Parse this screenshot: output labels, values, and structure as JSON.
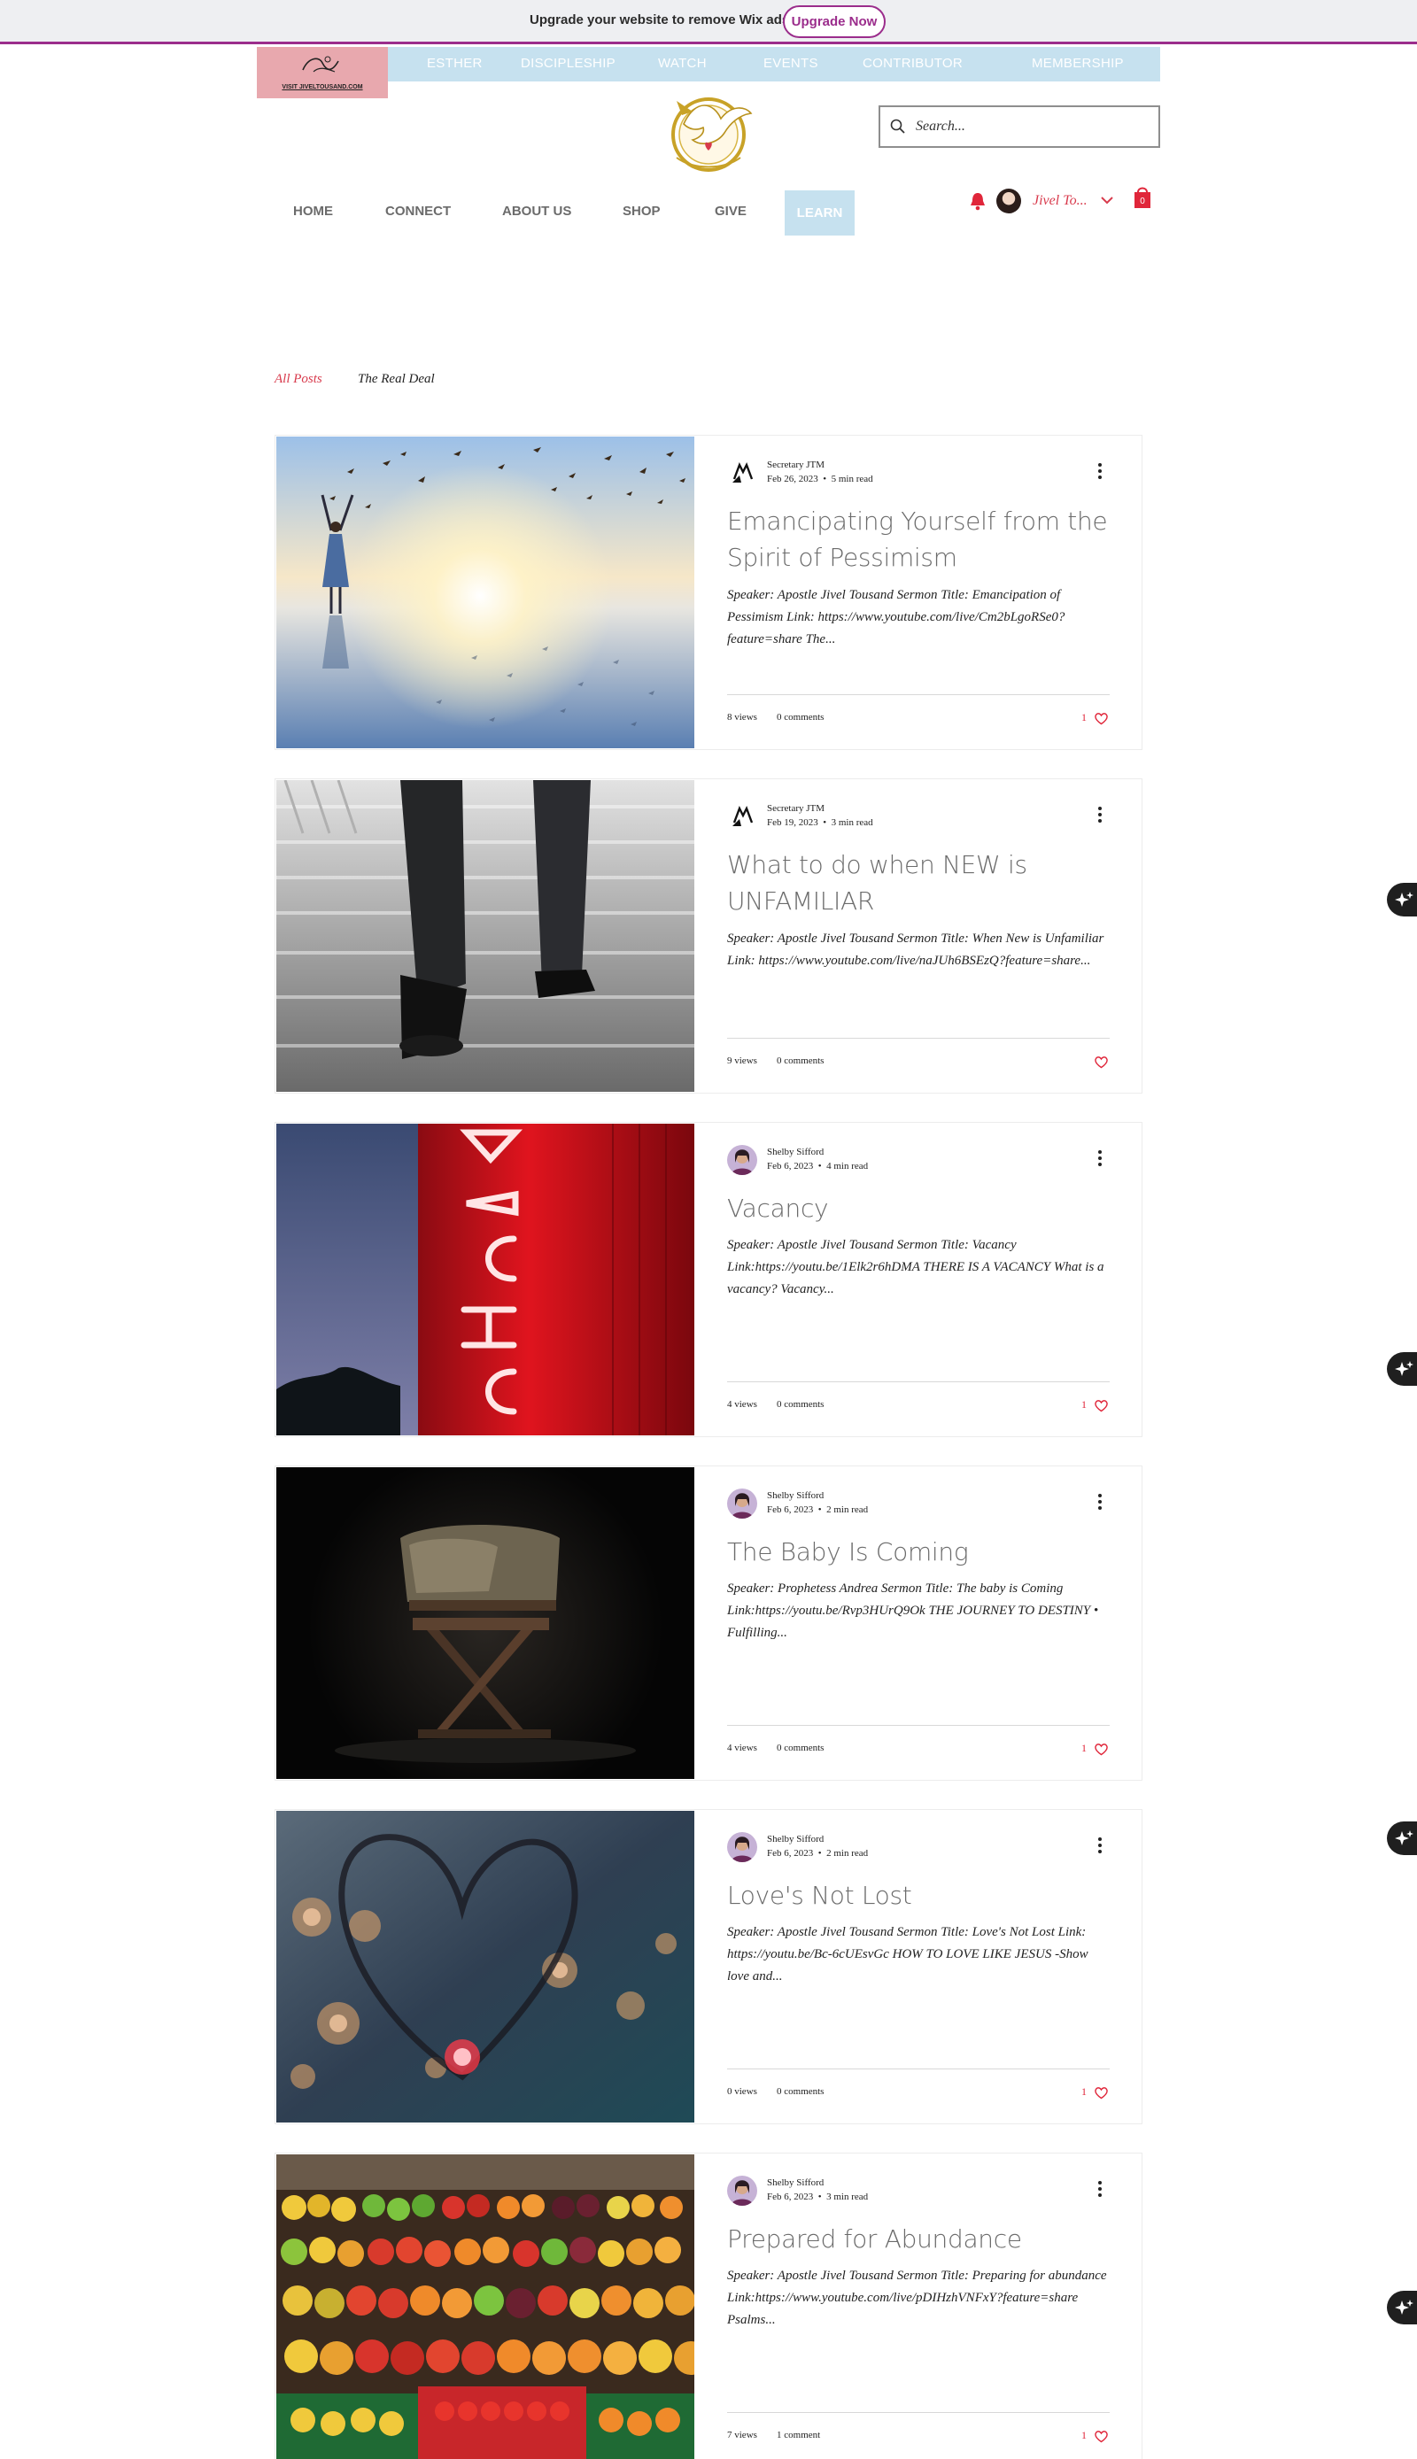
{
  "wix_bar": {
    "message": "Upgrade your website to remove Wix ads",
    "button": "Upgrade Now"
  },
  "logo_text": "VISIT JIVELTOUSAND.COM",
  "top_strip": [
    "ESTHER",
    "DISCIPLESHIP",
    "WATCH",
    "EVENTS",
    "CONTRIBUTOR",
    "MEMBERSHIP"
  ],
  "search": {
    "placeholder": "Search..."
  },
  "nav": [
    "HOME",
    "CONNECT",
    "ABOUT US",
    "SHOP",
    "GIVE",
    "LEARN"
  ],
  "user": {
    "name": "Jivel To...",
    "cart_count": "0"
  },
  "filters": {
    "all": "All Posts",
    "category": "The Real Deal"
  },
  "posts": [
    {
      "author": "Secretary JTM",
      "date": "Feb 26, 2023",
      "read": "5 min read",
      "title": "Emancipating Yourself from the Spirit of Pessimism",
      "excerpt": "Speaker: Apostle Jivel Tousand Sermon Title: Emancipation of Pessimism Link: https://www.youtube.com/live/Cm2bLgoRSe0?feature=share The...",
      "views": "8 views",
      "comments": "0 comments",
      "likes": "1"
    },
    {
      "author": "Secretary JTM",
      "date": "Feb 19, 2023",
      "read": "3 min read",
      "title": "What to do when NEW is UNFAMILIAR",
      "excerpt": "Speaker: Apostle Jivel Tousand Sermon Title: When New is Unfamiliar Link: https://www.youtube.com/live/naJUh6BSEzQ?feature=share...",
      "views": "9 views",
      "comments": "0 comments",
      "likes": ""
    },
    {
      "author": "Shelby Sifford",
      "date": "Feb 6, 2023",
      "read": "4 min read",
      "title": "Vacancy",
      "excerpt": "Speaker: Apostle Jivel Tousand Sermon Title: Vacancy Link:https://youtu.be/1Elk2r6hDMA THERE IS A VACANCY What is a vacancy? Vacancy...",
      "views": "4 views",
      "comments": "0 comments",
      "likes": "1"
    },
    {
      "author": "Shelby Sifford",
      "date": "Feb 6, 2023",
      "read": "2 min read",
      "title": "The Baby Is Coming",
      "excerpt": "Speaker: Prophetess Andrea Sermon Title: The baby is Coming Link:https://youtu.be/Rvp3HUrQ9Ok THE JOURNEY TO DESTINY • Fulfilling...",
      "views": "4 views",
      "comments": "0 comments",
      "likes": "1"
    },
    {
      "author": "Shelby Sifford",
      "date": "Feb 6, 2023",
      "read": "2 min read",
      "title": "Love's Not Lost",
      "excerpt": "Speaker: Apostle Jivel Tousand Sermon Title: Love's Not Lost Link: https://youtu.be/Bc-6cUEsvGc HOW TO LOVE LIKE JESUS -Show love and...",
      "views": "0 views",
      "comments": "0 comments",
      "likes": "1"
    },
    {
      "author": "Shelby Sifford",
      "date": "Feb 6, 2023",
      "read": "3 min read",
      "title": "Prepared for Abundance",
      "excerpt": "Speaker: Apostle Jivel Tousand Sermon Title: Preparing for abundance Link:https://www.youtube.com/live/pDIHzhVNFxY?feature=share Psalms...",
      "views": "7 views",
      "comments": "1 comment",
      "likes": "1"
    }
  ],
  "colors": {
    "accent": "#d83a4c",
    "strip": "#c6e1ef",
    "wix": "#9b2d8c",
    "like": "#e0263a"
  },
  "icons": [
    "search-icon",
    "bell-icon",
    "chevron-down-icon",
    "cart-icon",
    "more-icon",
    "heart-icon",
    "sparkle-icon"
  ]
}
